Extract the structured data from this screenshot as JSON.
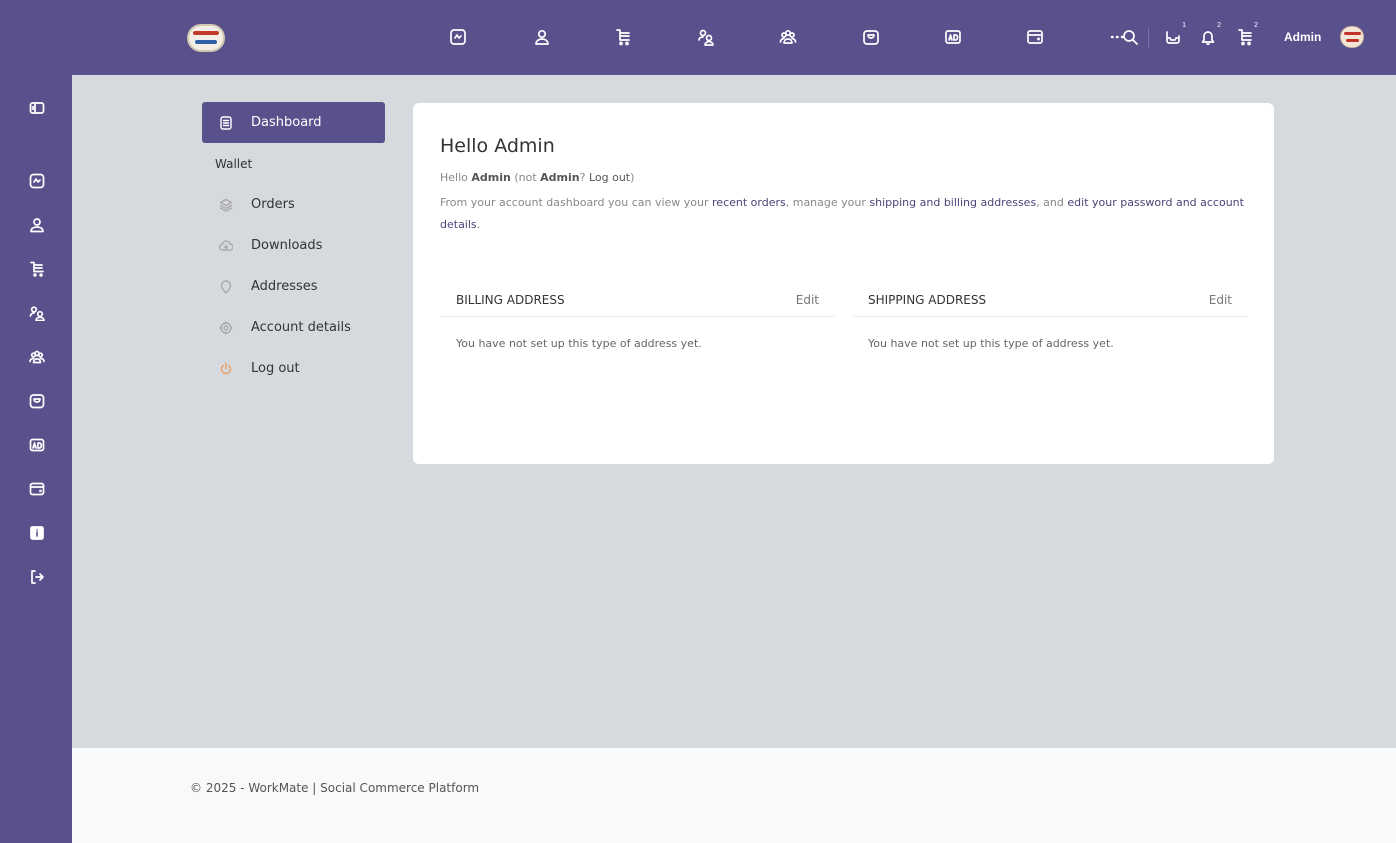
{
  "topbar": {
    "icons": [
      "feed-icon",
      "user-icon",
      "shop-cart-icon",
      "friends-icon",
      "groups-icon",
      "store-icon",
      "ads-icon",
      "wallet-icon",
      "more-icon"
    ],
    "search_icon": "search-icon",
    "notifications": [
      {
        "icon": "message-icon",
        "count": "1"
      },
      {
        "icon": "bell-icon",
        "count": "2"
      },
      {
        "icon": "cart-icon",
        "count": "2"
      }
    ],
    "user_name": "Admin"
  },
  "sidebar": {
    "icons": [
      "collapse-icon",
      "feed-icon",
      "user-icon",
      "shop-cart-icon",
      "friends-icon",
      "groups-icon",
      "store-icon",
      "ads-icon",
      "wallet-icon",
      "info-icon",
      "logout-icon"
    ]
  },
  "account_nav": {
    "items": [
      {
        "label": "Dashboard",
        "icon": "dashboard-icon",
        "active": true
      },
      {
        "label": "Wallet",
        "icon": "",
        "active": false
      },
      {
        "label": "Orders",
        "icon": "orders-icon",
        "active": false
      },
      {
        "label": "Downloads",
        "icon": "downloads-icon",
        "active": false
      },
      {
        "label": "Addresses",
        "icon": "location-icon",
        "active": false
      },
      {
        "label": "Account details",
        "icon": "settings-icon",
        "active": false
      },
      {
        "label": "Log out",
        "icon": "power-icon",
        "active": false
      }
    ]
  },
  "main": {
    "title": "Hello Admin",
    "greeting": {
      "hello": "Hello",
      "name": "Admin",
      "not": "(not",
      "name2": "Admin",
      "question": "?",
      "logout_link": "Log out",
      "close": ")"
    },
    "description": {
      "part1": "From your account dashboard you can view your",
      "link1": "recent orders",
      "part2": ", manage your",
      "link2": "shipping and billing addresses",
      "part3": ", and",
      "link3": "edit your password and account details",
      "part4": "."
    },
    "billing": {
      "heading": "BILLING ADDRESS",
      "edit": "Edit",
      "text": "You have not set up this type of address yet."
    },
    "shipping": {
      "heading": "SHIPPING ADDRESS",
      "edit": "Edit",
      "text": "You have not set up this type of address yet."
    }
  },
  "footer": {
    "text": "© 2025 - WorkMate | Social Commerce Platform"
  }
}
